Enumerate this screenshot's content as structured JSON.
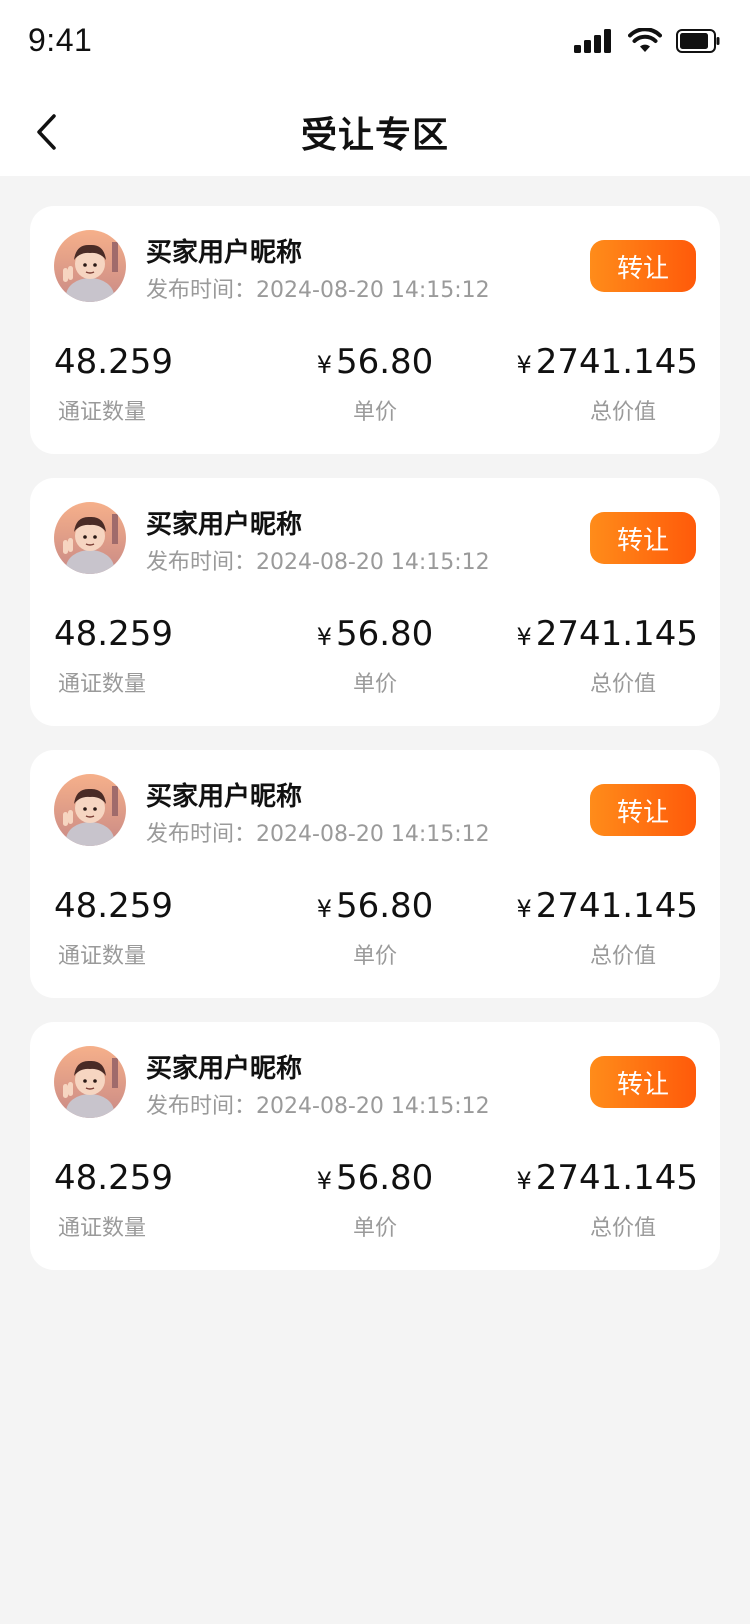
{
  "status_bar": {
    "time": "9:41"
  },
  "nav": {
    "title": "受让专区"
  },
  "labels": {
    "transfer_button": "转让",
    "publish_prefix": "发布时间：",
    "qty_label": "通证数量",
    "price_label": "单价",
    "total_label": "总价值",
    "currency": "¥"
  },
  "listings": [
    {
      "user_name": "买家用户昵称",
      "publish_time": "2024-08-20 14:15:12",
      "quantity": "48.259",
      "unit_price": "56.80",
      "total_value": "2741.145"
    },
    {
      "user_name": "买家用户昵称",
      "publish_time": "2024-08-20 14:15:12",
      "quantity": "48.259",
      "unit_price": "56.80",
      "total_value": "2741.145"
    },
    {
      "user_name": "买家用户昵称",
      "publish_time": "2024-08-20 14:15:12",
      "quantity": "48.259",
      "unit_price": "56.80",
      "total_value": "2741.145"
    },
    {
      "user_name": "买家用户昵称",
      "publish_time": "2024-08-20 14:15:12",
      "quantity": "48.259",
      "unit_price": "56.80",
      "total_value": "2741.145"
    }
  ],
  "colors": {
    "accent_start": "#ff8c1a",
    "accent_end": "#ff5a0a",
    "muted_text": "#9a9a9a",
    "page_bg": "#f4f4f4"
  }
}
